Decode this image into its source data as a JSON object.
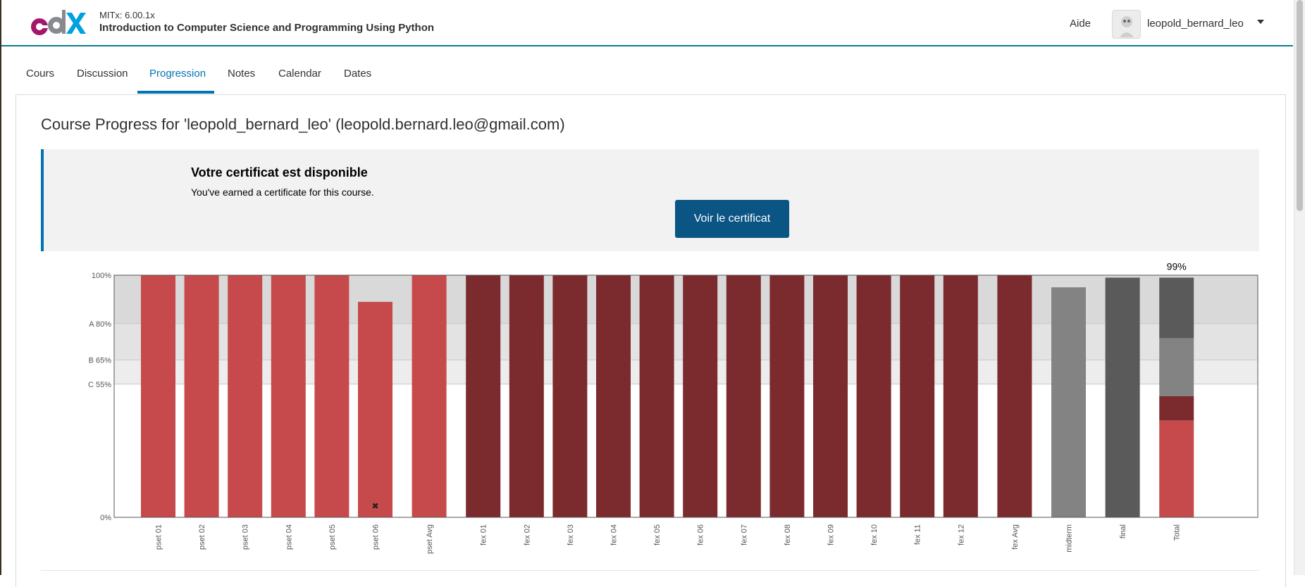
{
  "header": {
    "course_org": "MITx: 6.00.1x",
    "course_title": "Introduction to Computer Science and Programming Using Python",
    "help_label": "Aide",
    "username": "leopold_bernard_leo"
  },
  "tabs": [
    {
      "label": "Cours"
    },
    {
      "label": "Discussion"
    },
    {
      "label": "Progression",
      "active": true
    },
    {
      "label": "Notes"
    },
    {
      "label": "Calendar"
    },
    {
      "label": "Dates"
    }
  ],
  "page_title": "Course Progress for 'leopold_bernard_leo' (leopold.bernard.leo@gmail.com)",
  "certificate": {
    "title": "Votre certificat est disponible",
    "description": "You've earned a certificate for this course.",
    "button_label": "Voir le certificat"
  },
  "colors": {
    "accent": "#0075b4",
    "button": "#0a5584",
    "pset": "#c64a4b",
    "fex": "#7b2b2e",
    "midterm": "#838383",
    "final": "#5a5a5a"
  },
  "chart_data": {
    "type": "bar",
    "ylim": [
      0,
      100
    ],
    "y_ticks": [
      {
        "value": 100,
        "label": "100%"
      },
      {
        "value": 80,
        "label": "A 80%"
      },
      {
        "value": 65,
        "label": "B 65%"
      },
      {
        "value": 55,
        "label": "C 55%"
      },
      {
        "value": 0,
        "label": "0%"
      }
    ],
    "grade_bands": [
      {
        "from": 80,
        "to": 100,
        "color": "#d9d9d9"
      },
      {
        "from": 65,
        "to": 80,
        "color": "#e3e3e3"
      },
      {
        "from": 55,
        "to": 65,
        "color": "#ededed"
      }
    ],
    "bars": [
      {
        "label": "pset 01",
        "value": 100,
        "color": "#c64a4b"
      },
      {
        "label": "pset 02",
        "value": 100,
        "color": "#c64a4b"
      },
      {
        "label": "pset 03",
        "value": 100,
        "color": "#c64a4b"
      },
      {
        "label": "pset 04",
        "value": 100,
        "color": "#c64a4b"
      },
      {
        "label": "pset 05",
        "value": 100,
        "color": "#c64a4b"
      },
      {
        "label": "pset 06",
        "value": 89,
        "color": "#c64a4b",
        "dropped": true
      },
      {
        "label": "pset Avg",
        "value": 100,
        "color": "#c64a4b",
        "gap_before": true
      },
      {
        "label": "fex 01",
        "value": 100,
        "color": "#7b2b2e",
        "gap_before": true
      },
      {
        "label": "fex 02",
        "value": 100,
        "color": "#7b2b2e"
      },
      {
        "label": "fex 03",
        "value": 100,
        "color": "#7b2b2e"
      },
      {
        "label": "fex 04",
        "value": 100,
        "color": "#7b2b2e"
      },
      {
        "label": "fex 05",
        "value": 100,
        "color": "#7b2b2e"
      },
      {
        "label": "fex 06",
        "value": 100,
        "color": "#7b2b2e"
      },
      {
        "label": "fex 07",
        "value": 100,
        "color": "#7b2b2e"
      },
      {
        "label": "fex 08",
        "value": 100,
        "color": "#7b2b2e"
      },
      {
        "label": "fex 09",
        "value": 100,
        "color": "#7b2b2e"
      },
      {
        "label": "fex 10",
        "value": 100,
        "color": "#7b2b2e"
      },
      {
        "label": "fex 11",
        "value": 100,
        "color": "#7b2b2e"
      },
      {
        "label": "fex 12",
        "value": 100,
        "color": "#7b2b2e"
      },
      {
        "label": "fex Avg",
        "value": 100,
        "color": "#7b2b2e",
        "gap_before": true
      },
      {
        "label": "midterm",
        "value": 95,
        "color": "#838383",
        "gap_before": true
      },
      {
        "label": "final",
        "value": 99,
        "color": "#5a5a5a",
        "gap_before": true
      },
      {
        "label": "Total",
        "gap_before": true,
        "total_label": "99%",
        "stack": [
          {
            "value": 40,
            "color": "#c64a4b"
          },
          {
            "value": 10,
            "color": "#7b2b2e"
          },
          {
            "value": 24,
            "color": "#838383"
          },
          {
            "value": 25,
            "color": "#5a5a5a"
          }
        ]
      }
    ]
  }
}
